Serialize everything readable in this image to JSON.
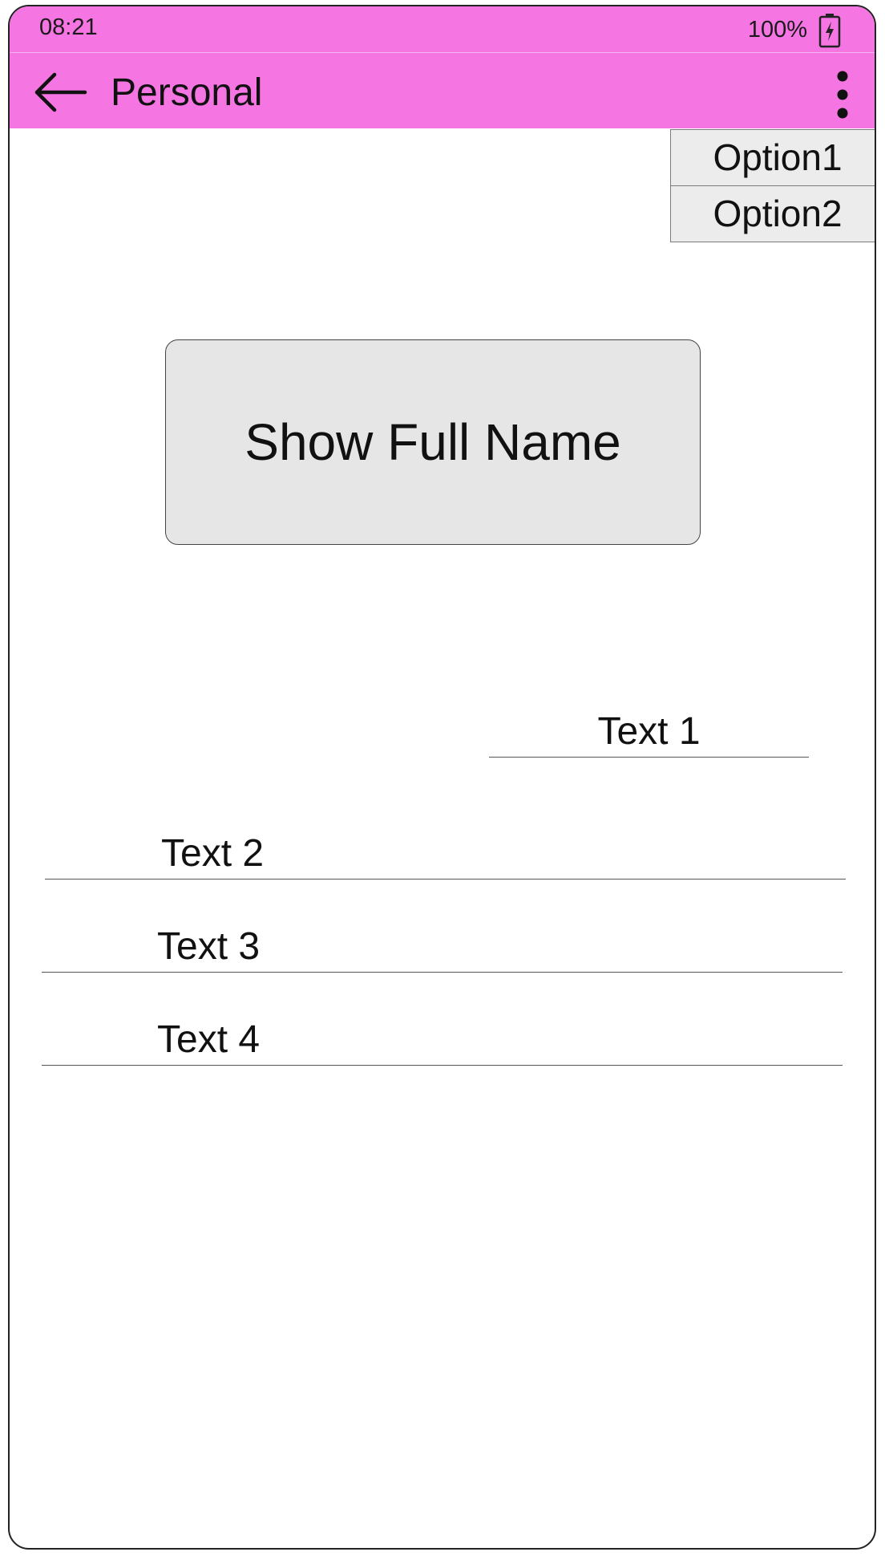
{
  "status_bar": {
    "time": "08:21",
    "battery_text": "100%",
    "battery_icon": "battery-charging-icon"
  },
  "app_bar": {
    "title": "Personal",
    "back_icon": "arrow-back-icon",
    "more_icon": "more-vertical-icon",
    "background_color": "#f575e3"
  },
  "overflow_menu": {
    "items": [
      {
        "label": "Option1"
      },
      {
        "label": "Option2"
      }
    ]
  },
  "main": {
    "button_label": "Show Full Name",
    "fields": [
      {
        "value": "Text 1"
      },
      {
        "value": "Text 2"
      },
      {
        "value": "Text 3"
      },
      {
        "value": "Text 4"
      }
    ]
  }
}
